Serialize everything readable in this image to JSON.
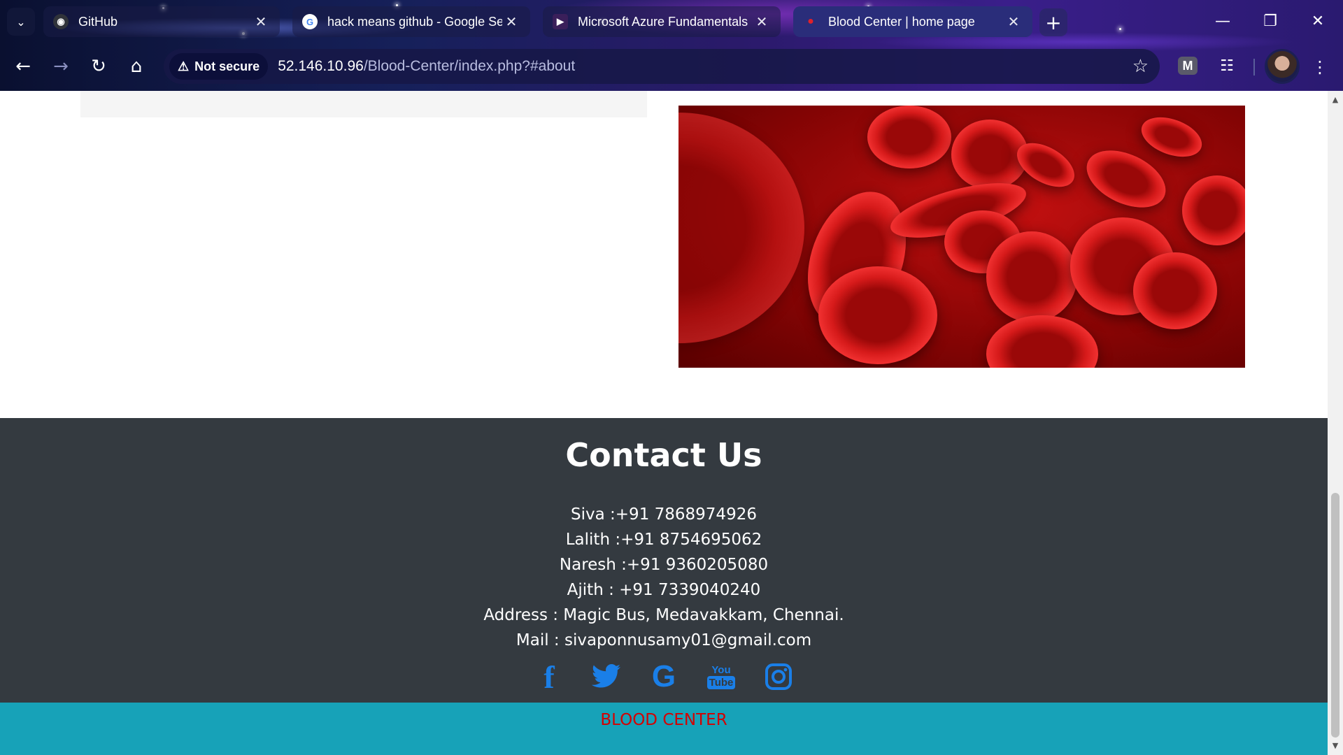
{
  "browser": {
    "tabs": [
      {
        "title": "GitHub",
        "active": false,
        "icon": "github-icon"
      },
      {
        "title": "hack means github - Google Search",
        "active": false,
        "icon": "google-icon"
      },
      {
        "title": "Microsoft Azure Fundamentals",
        "active": false,
        "icon": "youtube-icon"
      },
      {
        "title": "Blood Center | home page",
        "active": true,
        "icon": "blood-drop-icon"
      }
    ],
    "security_label": "Not secure",
    "url_host": "52.146.10.96",
    "url_path": "/Blood-Center/index.php?#about"
  },
  "contact": {
    "heading": "Contact Us",
    "lines": [
      "Siva :+91 7868974926",
      "Lalith :+91 8754695062",
      "Naresh :+91 9360205080",
      "Ajith : +91 7339040240",
      "Address : Magic Bus, Medavakkam, Chennai.",
      "Mail : sivaponnusamy01@gmail.com"
    ],
    "socials": [
      "facebook-icon",
      "twitter-icon",
      "google-icon",
      "youtube-icon",
      "instagram-icon"
    ]
  },
  "footer": {
    "label": "BLOOD CENTER"
  },
  "colors": {
    "contact_bg": "#343a40",
    "footer_bg": "#17a2b8",
    "footer_text": "#d40000",
    "social_icon": "#1a7fe8"
  }
}
